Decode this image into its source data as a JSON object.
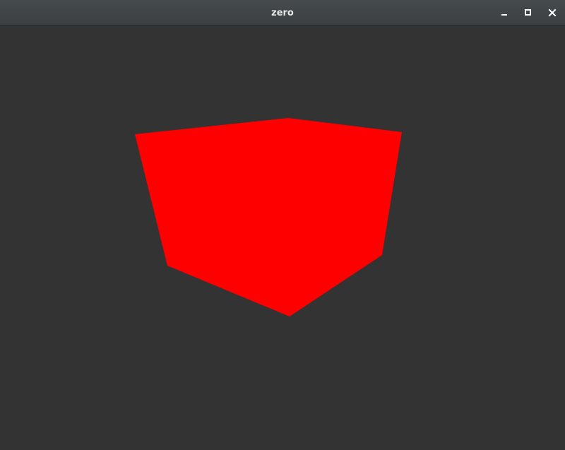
{
  "window": {
    "title": "zero",
    "buttons": {
      "minimize": "minimize-icon",
      "maximize": "maximize-icon",
      "close": "close-icon"
    }
  },
  "scene": {
    "background_color": "#333333",
    "cube_color": "#ff0000"
  }
}
